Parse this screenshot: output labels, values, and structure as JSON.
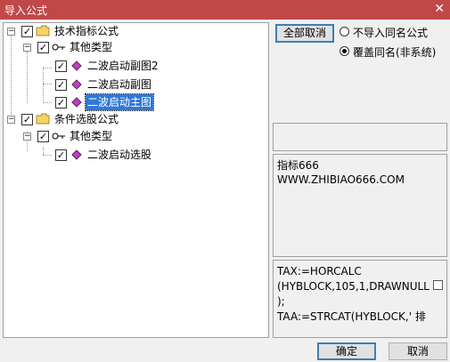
{
  "window": {
    "title": "导入公式",
    "close_glyph": "✕"
  },
  "tree": {
    "groups": [
      {
        "label": "技术指标公式",
        "category": "其他类型",
        "items": [
          "二波启动副图2",
          "二波启动副图",
          "二波启动主图"
        ]
      },
      {
        "label": "条件选股公式",
        "category": "其他类型",
        "items": [
          "二波启动选股"
        ]
      }
    ],
    "selected_item": "二波启动主图"
  },
  "actions": {
    "cancel_all": "全部取消"
  },
  "import_options": {
    "no_import_same_name": "不导入同名公式",
    "overwrite_same_name": "覆盖同名(非系统)",
    "selected": "overwrite_same_name"
  },
  "description": {
    "line1": "指标666",
    "line2": "WWW.ZHIBIAO666.COM"
  },
  "code_preview": {
    "line1": "TAX:=HORCALC",
    "line2": "(HYBLOCK,105,1,DRAWNULL",
    "line3": ");",
    "line4": "TAA:=STRCAT(HYBLOCK,' 排"
  },
  "footer": {
    "ok": "确定",
    "cancel": "取消"
  },
  "colors": {
    "titlebar": "#c04848",
    "selection": "#3078d8",
    "formula_icon": "#c040c0"
  }
}
